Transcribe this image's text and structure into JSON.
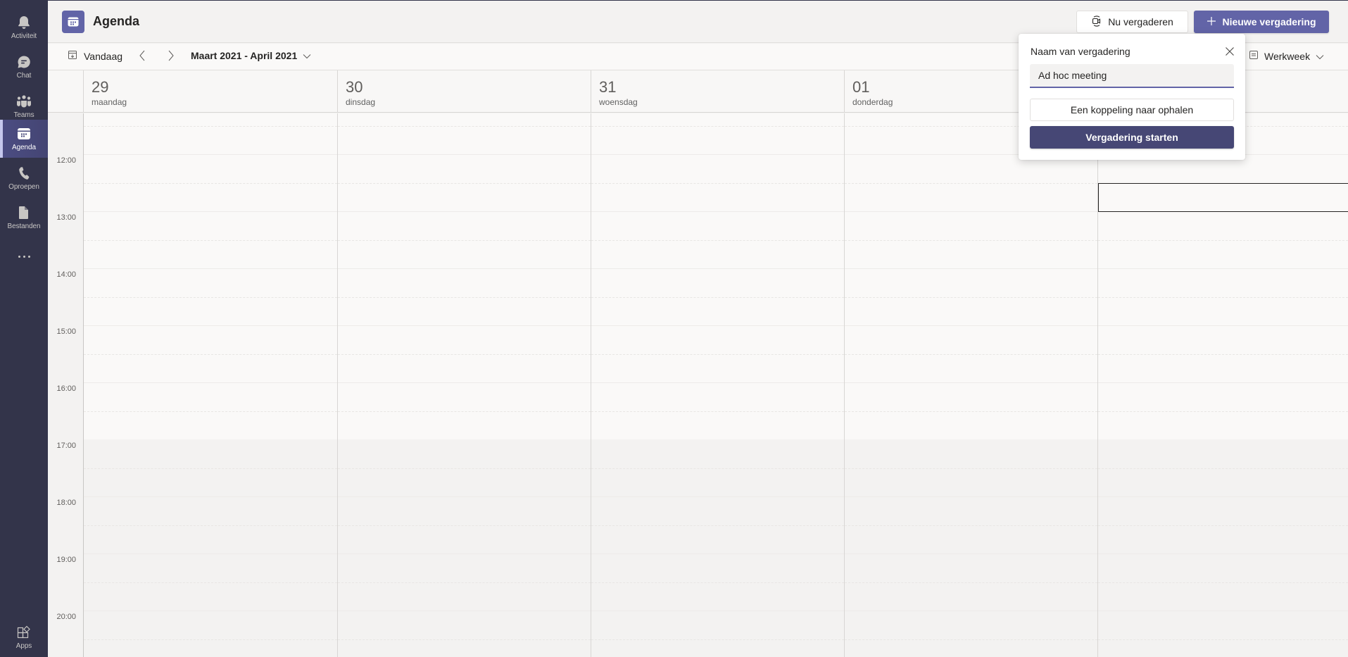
{
  "appbar": {
    "items": [
      {
        "id": "activity",
        "label": "Activiteit",
        "icon": "bell-icon",
        "active": false
      },
      {
        "id": "chat",
        "label": "Chat",
        "icon": "chat-icon",
        "active": false
      },
      {
        "id": "teams",
        "label": "Teams",
        "icon": "teams-icon",
        "active": false
      },
      {
        "id": "calendar",
        "label": "Agenda",
        "icon": "calendar-icon",
        "active": true
      },
      {
        "id": "calls",
        "label": "Oproepen",
        "icon": "phone-icon",
        "active": false
      },
      {
        "id": "files",
        "label": "Bestanden",
        "icon": "file-icon",
        "active": false
      }
    ],
    "more_icon": "more-dots-icon",
    "apps": {
      "label": "Apps",
      "icon": "apps-icon"
    }
  },
  "header": {
    "title": "Agenda",
    "meet_now_label": "Nu vergaderen",
    "new_meeting_label": "Nieuwe vergadering",
    "accent_color": "#6264a7"
  },
  "toolbar": {
    "today_label": "Vandaag",
    "range_label": "Maart 2021 - April 2021",
    "view_label": "Werkweek"
  },
  "days": [
    {
      "number": "29",
      "weekday": "maandag"
    },
    {
      "number": "30",
      "weekday": "dinsdag"
    },
    {
      "number": "31",
      "weekday": "woensdag"
    },
    {
      "number": "01",
      "weekday": "donderdag"
    },
    {
      "number": "",
      "weekday": ""
    }
  ],
  "times": [
    "12:00",
    "13:00",
    "14:00",
    "15:00",
    "16:00",
    "17:00",
    "18:00",
    "19:00",
    "20:00"
  ],
  "work_hours_end": "17:00",
  "selected_slot": {
    "day_index": 4,
    "start": "12:30",
    "end": "13:00"
  },
  "popup": {
    "title": "Naam van vergadering",
    "input_value": "Ad hoc meeting",
    "get_link_label": "Een koppeling naar ophalen",
    "start_label": "Vergadering starten",
    "start_color": "#464775"
  }
}
